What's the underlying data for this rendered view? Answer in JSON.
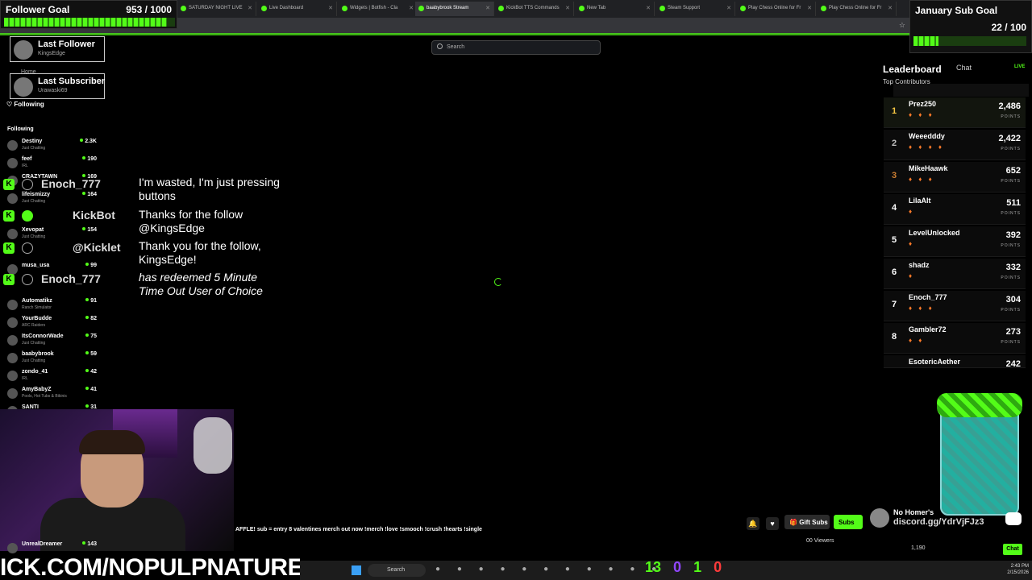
{
  "browser": {
    "tabs": [
      {
        "label": "",
        "active": false
      },
      {
        "label": "SATURDAY NIGHT LIVE",
        "active": false
      },
      {
        "label": "Live Dashboard",
        "active": false
      },
      {
        "label": "Widgets | Botfish - Cla",
        "active": false
      },
      {
        "label": "baabybrook Stream",
        "active": true
      },
      {
        "label": "KickBot TTS Commands",
        "active": false
      },
      {
        "label": "New Tab",
        "active": false
      },
      {
        "label": "Steam Support",
        "active": false
      },
      {
        "label": "Play Chess Online for Fr",
        "active": false
      },
      {
        "label": "Play Chess Online for Fr",
        "active": false
      }
    ]
  },
  "follower_goal": {
    "title": "Follower Goal",
    "value": "953 / 1000",
    "progress": 0.953
  },
  "sub_goal": {
    "title": "January Sub Goal",
    "value": "22 / 100",
    "progress": 0.22
  },
  "search": {
    "placeholder": "Search"
  },
  "last_follower": {
    "title": "Last Follower",
    "name": "KingsEdge"
  },
  "last_subscriber": {
    "title": "Last Subscriber",
    "name": "Urawaski69"
  },
  "sidebar": {
    "home": "Home",
    "following_nav": "Following",
    "following_header": "Following",
    "channels": [
      {
        "name": "Destiny",
        "category": "Just Chatting",
        "viewers": "2.3K"
      },
      {
        "name": "feef",
        "category": "IRL",
        "viewers": "190"
      },
      {
        "name": "CRAZYTAWN",
        "category": "",
        "viewers": "169"
      },
      {
        "name": "lifeismizzy",
        "category": "Just Chatting",
        "viewers": "164"
      },
      {
        "name": "",
        "category": "",
        "viewers": ""
      },
      {
        "name": "Xevopat",
        "category": "Just Chatting",
        "viewers": "154"
      },
      {
        "name": "",
        "category": "Ranch Simulator",
        "viewers": ""
      },
      {
        "name": "musa_usa",
        "category": "",
        "viewers": "99"
      },
      {
        "name": "",
        "category": "IRL",
        "viewers": ""
      },
      {
        "name": "Automatikz",
        "category": "Ranch Simulator",
        "viewers": "91"
      },
      {
        "name": "YourBudde",
        "category": "ARC Raiders",
        "viewers": "82"
      },
      {
        "name": "ItsConnorWade",
        "category": "Just Chatting",
        "viewers": "75"
      },
      {
        "name": "baabybrook",
        "category": "Just Chatting",
        "viewers": "59"
      },
      {
        "name": "zondo_41",
        "category": "IRL",
        "viewers": "42"
      },
      {
        "name": "AmyBabyZ",
        "category": "Pools, Hot Tubs & Bikinis",
        "viewers": "41"
      },
      {
        "name": "SANTI",
        "category": "",
        "viewers": "31"
      }
    ],
    "bottom_channel": {
      "name": "UnrealDreamer",
      "viewers": "143"
    }
  },
  "chat_overlay": [
    {
      "user": "Enoch_777",
      "message": "I'm wasted, I'm just pressing buttons",
      "italic": false
    },
    {
      "user": "KickBot",
      "message": "Thanks for the follow @KingsEdge",
      "italic": false
    },
    {
      "user": "@Kicklet",
      "message": "Thank you for the follow, KingsEdge!",
      "italic": false
    },
    {
      "user": "Enoch_777",
      "message": "has redeemed 5 Minute Time Out User of Choice",
      "italic": true
    }
  ],
  "leaderboard": {
    "tab": "Leaderboard",
    "chat_tab": "Chat",
    "live": "LIVE",
    "subtitle": "Top Contributors",
    "points_label": "POINTS",
    "entries": [
      {
        "rank": "1",
        "name": "Prez250",
        "points": "2,486",
        "badges": "♦ ♦ ♦"
      },
      {
        "rank": "2",
        "name": "Weeedddy",
        "points": "2,422",
        "badges": "♦ ♦ ♦ ♦"
      },
      {
        "rank": "3",
        "name": "MikeHaawk",
        "points": "652",
        "badges": "♦ ♦ ♦"
      },
      {
        "rank": "4",
        "name": "LilaAlt",
        "points": "511",
        "badges": "♦"
      },
      {
        "rank": "5",
        "name": "LevelUnlocked",
        "points": "392",
        "badges": "♦"
      },
      {
        "rank": "6",
        "name": "shadz",
        "points": "332",
        "badges": "♦"
      },
      {
        "rank": "7",
        "name": "Enoch_777",
        "points": "304",
        "badges": "♦ ♦ ♦"
      },
      {
        "rank": "8",
        "name": "Gambler72",
        "points": "273",
        "badges": "♦ ♦"
      },
      {
        "rank": "",
        "name": "EsotericAether",
        "points": "242",
        "badges": ""
      }
    ]
  },
  "ticker": "AFFLE! sub = entry 8 valentines merch out now !merch !love !smooch !crush !hearts !single",
  "actions": {
    "gift_subs": "Gift Subs",
    "subscribe": "Subs",
    "viewers": "00 Viewers",
    "chat": "Chat"
  },
  "discord": {
    "name": "No Homer's",
    "link": "discord.gg/YdrVjFJz3"
  },
  "footer_stats": "1,190",
  "banner": "ICK.COM/NOPULPNATURE",
  "taskbar": {
    "search": "Search",
    "stats": [
      "13",
      "0",
      "1",
      "0"
    ],
    "time": "2:43 PM",
    "date": "2/15/2026"
  },
  "colors": {
    "accent": "#53fc18",
    "background": "#000000"
  }
}
